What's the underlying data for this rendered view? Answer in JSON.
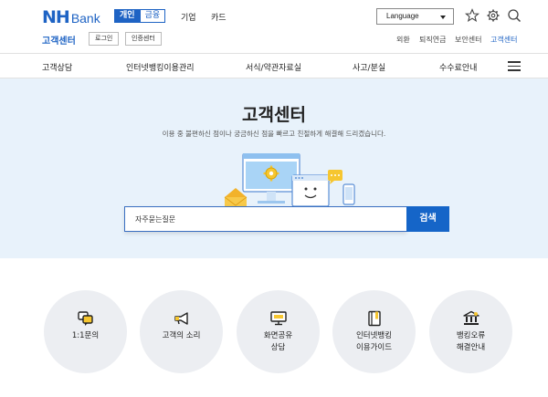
{
  "brand": {
    "nh": "NH",
    "bank": "Bank"
  },
  "segments": [
    "개인",
    "금융"
  ],
  "top_nav": [
    "기업",
    "카드"
  ],
  "language": {
    "label": "Language"
  },
  "header": {
    "section_title": "고객센터",
    "login_label": "로그인",
    "certificate_label": "인증센터"
  },
  "right_links": [
    "외환",
    "퇴직연금",
    "보안센터",
    "고객센터"
  ],
  "main_nav": [
    "고객상담",
    "인터넷뱅킹이용관리",
    "서식/약관자료실",
    "사고/분실",
    "수수료안내"
  ],
  "hero": {
    "title": "고객센터",
    "description": "이용 중 불편하신 점이나 궁금하신 점을 빠르고 친절하게 해결해 드리겠습니다.",
    "search_placeholder": "자주묻는질문",
    "search_button": "검색"
  },
  "quick_menu": [
    {
      "icon": "chat-bubbles-icon",
      "label1": "1:1문의",
      "label2": ""
    },
    {
      "icon": "megaphone-icon",
      "label1": "고객의 소리",
      "label2": ""
    },
    {
      "icon": "screen-share-icon",
      "label1": "화면공유",
      "label2": "상담"
    },
    {
      "icon": "guide-book-icon",
      "label1": "인터넷뱅킹",
      "label2": "이용가이드"
    },
    {
      "icon": "bank-building-icon",
      "label1": "뱅킹오류",
      "label2": "해결안내"
    }
  ],
  "colors": {
    "brand_blue": "#1e63c4",
    "hero_bg": "#e8f2fb",
    "circle_bg": "#eceef2",
    "search_button": "#1565c8"
  }
}
